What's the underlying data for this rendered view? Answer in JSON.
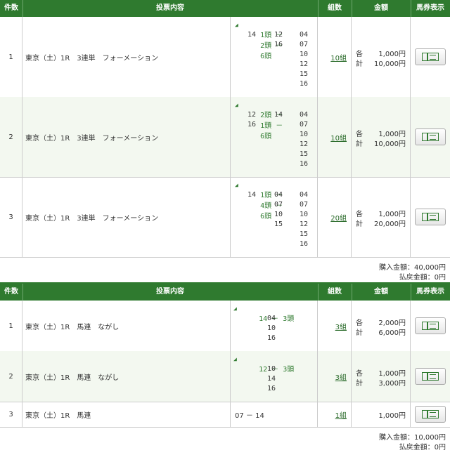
{
  "headers": {
    "num": "件数",
    "desc": "投票内容",
    "count": "組数",
    "amount": "金額",
    "display": "馬券表示"
  },
  "labels": {
    "each": "各",
    "total": "計"
  },
  "section1": {
    "rows": [
      {
        "num": "1",
        "desc": "東京（土）1R　3連単　フォーメーション",
        "combo_head": [
          "1頭",
          "2頭",
          "6頭"
        ],
        "combo_lines": [
          "14",
          "12",
          "04",
          "16",
          "07",
          "10",
          "12",
          "15",
          "16"
        ],
        "count": "10組",
        "each": "1,000円",
        "total": "10,000円"
      },
      {
        "num": "2",
        "desc": "東京（土）1R　3連単　フォーメーション",
        "combo_head": [
          "2頭",
          "1頭",
          "6頭"
        ],
        "combo_lines": [
          "12",
          "14",
          "04",
          "16",
          "07",
          "10",
          "12",
          "15",
          "16"
        ],
        "count": "10組",
        "each": "1,000円",
        "total": "10,000円"
      },
      {
        "num": "3",
        "desc": "東京（土）1R　3連単　フォーメーション",
        "combo_head": [
          "1頭",
          "4頭",
          "6頭"
        ],
        "combo_lines": [
          "14",
          "04",
          "04",
          "07",
          "07",
          "10",
          "10",
          "15",
          "12",
          "15",
          "16"
        ],
        "count": "20組",
        "each": "1,000円",
        "total": "20,000円"
      }
    ],
    "purchase": "購入金額：40,000円",
    "refund": "払戻金額：0円"
  },
  "section2": {
    "rows": [
      {
        "num": "1",
        "desc": "東京（土）1R　馬連　ながし",
        "combo_head": "14 － 3頭",
        "combo_lines": [
          "04",
          "10",
          "16"
        ],
        "count": "3組",
        "each": "2,000円",
        "total": "6,000円"
      },
      {
        "num": "2",
        "desc": "東京（土）1R　馬連　ながし",
        "combo_head": "12 － 3頭",
        "combo_lines": [
          "10",
          "14",
          "16"
        ],
        "count": "3組",
        "each": "1,000円",
        "total": "3,000円"
      },
      {
        "num": "3",
        "desc": "東京（土）1R　馬連",
        "combo_head": "07 － 14",
        "combo_lines": [],
        "count": "1組",
        "single": "1,000円"
      }
    ],
    "purchase": "購入金額：10,000円",
    "refund": "払戻金額：0円"
  },
  "colors": {
    "header": "#2f7a2f",
    "alt_row": "#f3f8f0",
    "link": "#2a6b2a"
  },
  "icons": {
    "display_button": "ticket-icon",
    "combo_marker": "triangle-marker-icon"
  }
}
